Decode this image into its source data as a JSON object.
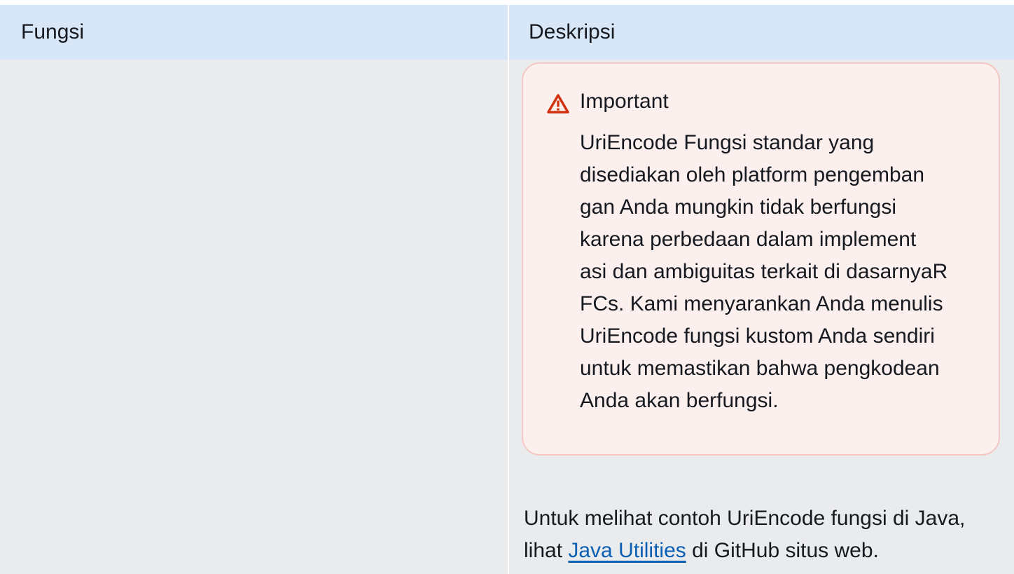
{
  "table": {
    "headers": [
      "Fungsi",
      "Deskripsi"
    ]
  },
  "alert": {
    "icon": "warning-triangle-icon",
    "icon_color": "#d13212",
    "title": "Important",
    "lines": [
      "UriEncode Fungsi standar yang",
      "disediakan oleh platform pengemban",
      "gan Anda mungkin tidak berfungsi",
      "karena perbedaan dalam implement",
      "asi dan ambiguitas terkait di dasarnyaR",
      "FCs. Kami menyarankan Anda menulis",
      "UriEncode fungsi kustom Anda sendiri",
      "untuk memastikan bahwa pengkodean",
      "Anda akan berfungsi."
    ]
  },
  "example": {
    "line1": "Untuk melihat contoh UriEncode fungsi di Java,",
    "prefix": "lihat ",
    "link_text": "Java Utilities",
    "suffix": " di GitHub situs web."
  },
  "colors": {
    "header_bg": "#d7e7f7",
    "row_bg": "#eaebed",
    "alert_bg": "#fbf0ee",
    "alert_border": "#f4c7c3",
    "link": "#0a5fb3"
  }
}
